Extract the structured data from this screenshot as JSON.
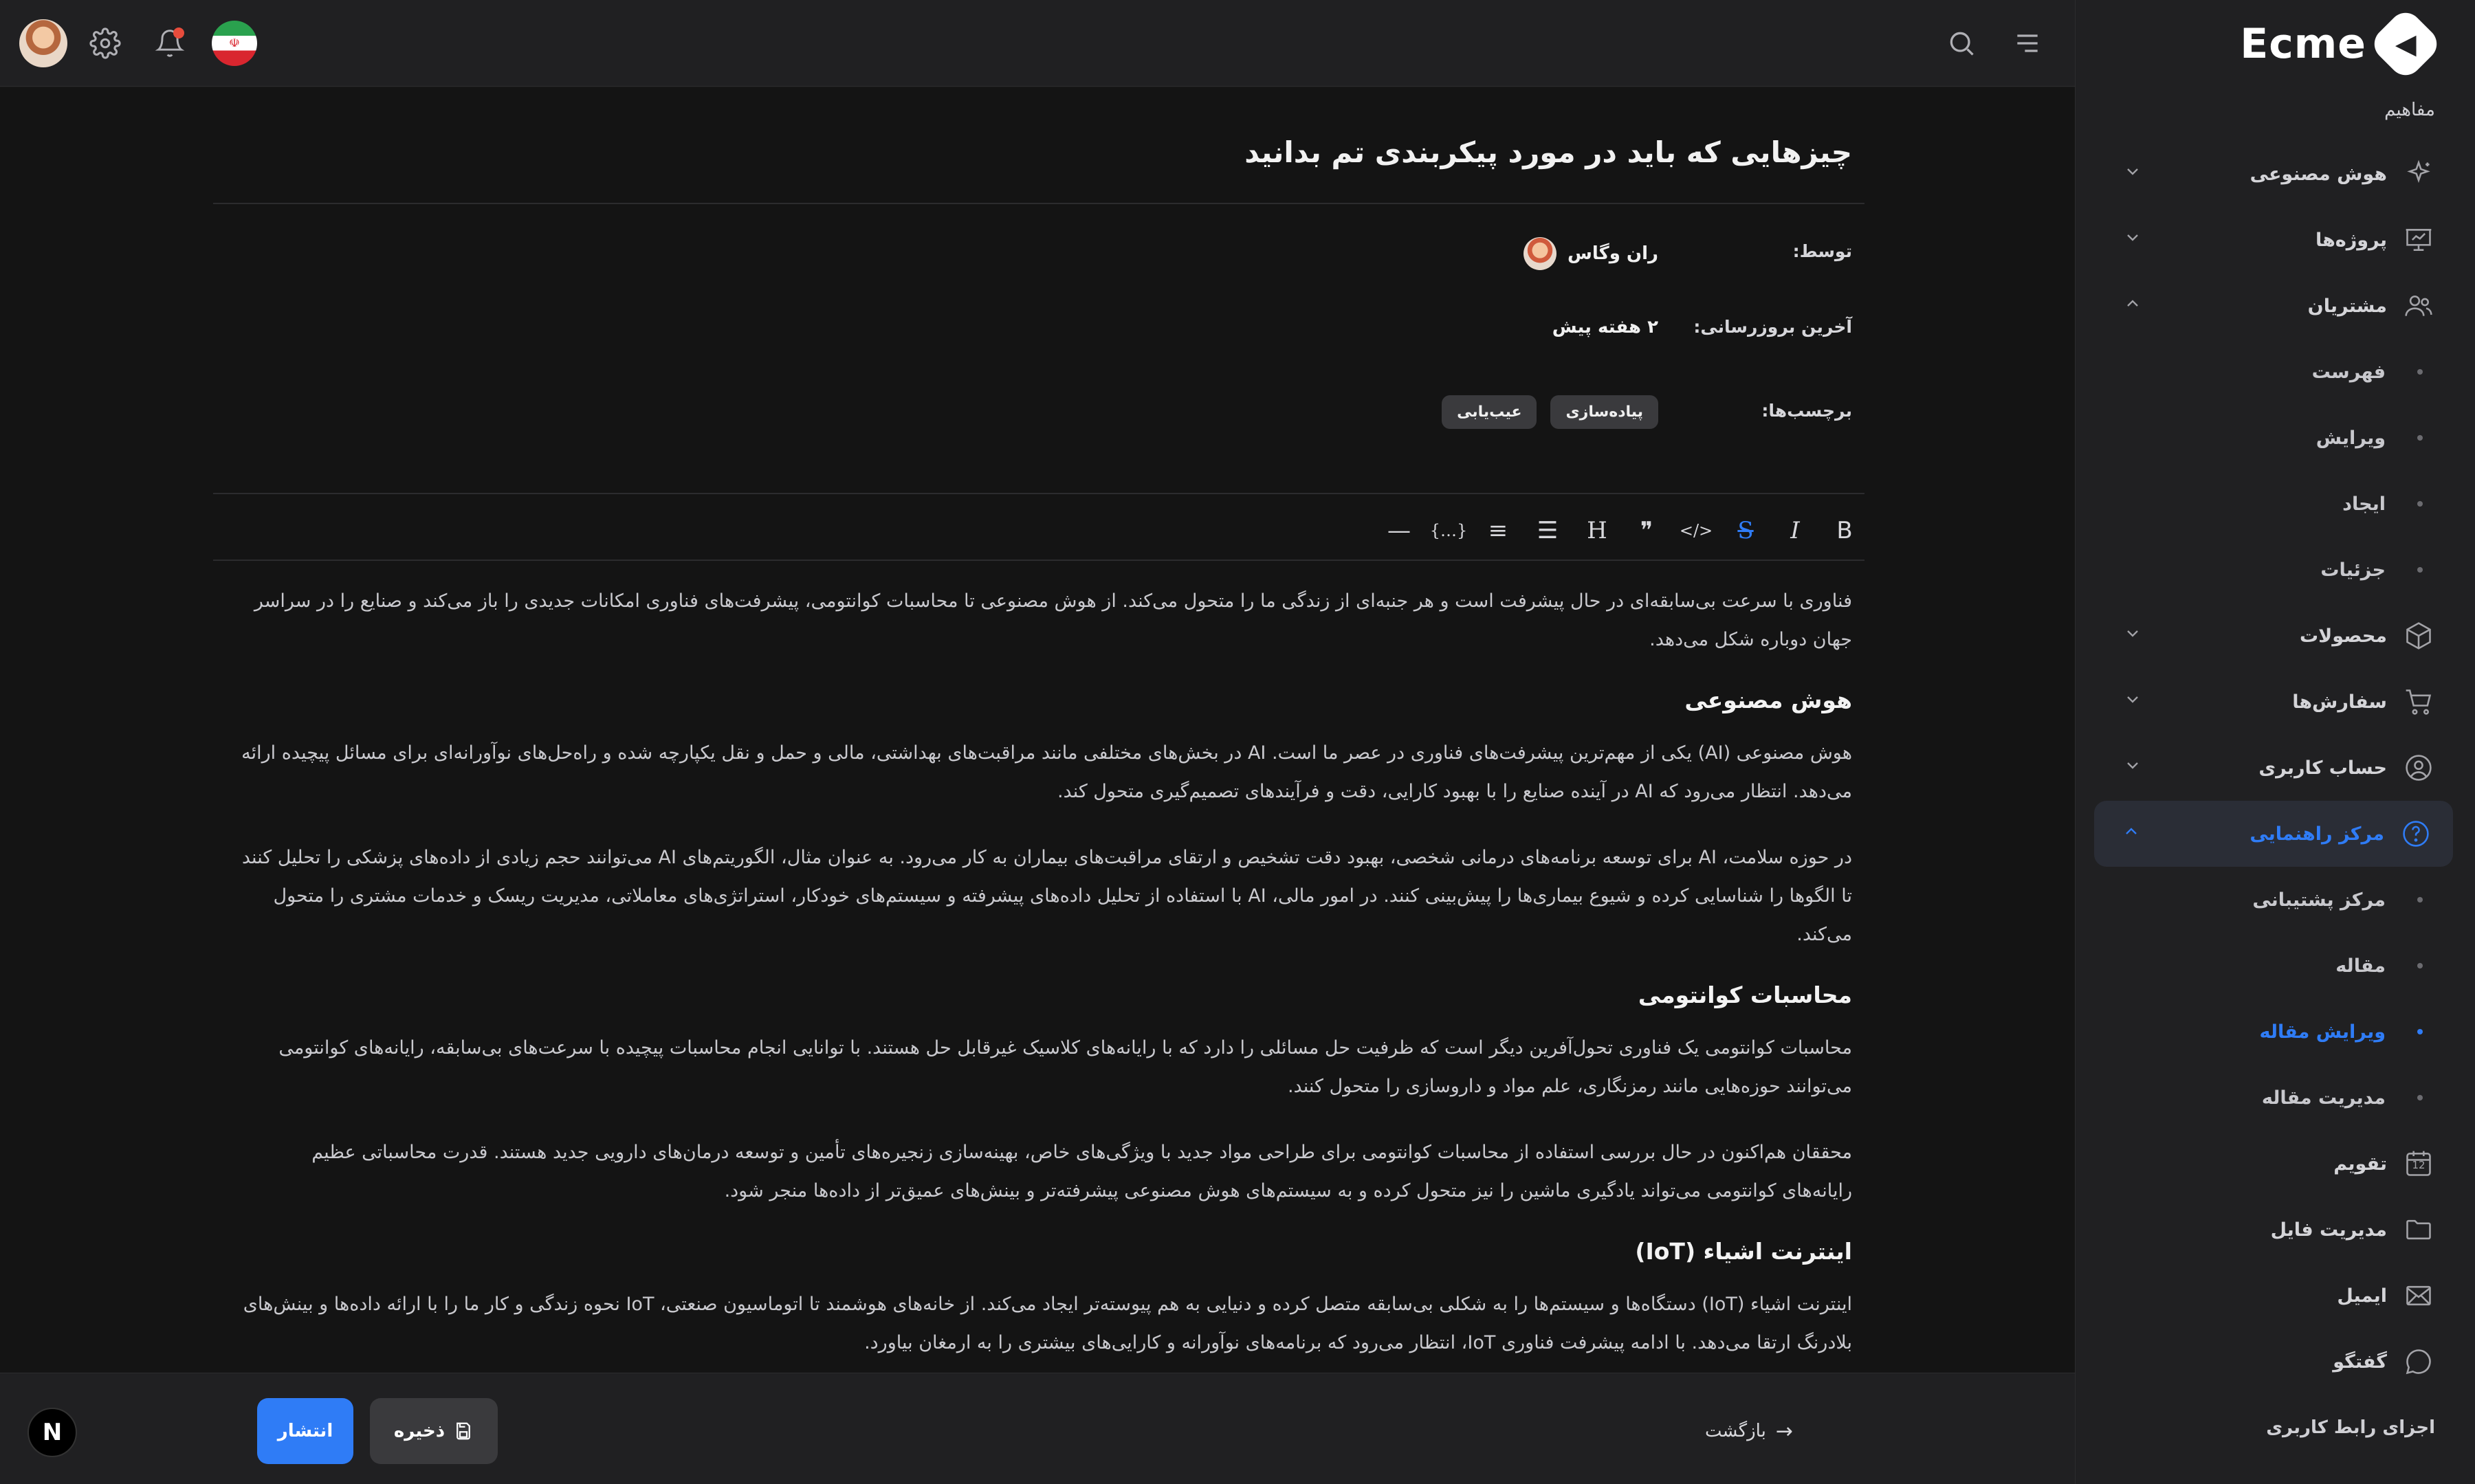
{
  "app": {
    "name": "Ecme"
  },
  "sidebar": {
    "section_title": "مفاهیم",
    "items": [
      {
        "label": "هوش مصنوعی",
        "icon": "sparkle-icon",
        "chevron": "down"
      },
      {
        "label": "پروژه‌ها",
        "icon": "presentation-icon",
        "chevron": "down"
      },
      {
        "label": "مشتریان",
        "icon": "users-icon",
        "chevron": "up"
      },
      {
        "label": "فهرست",
        "sub": true
      },
      {
        "label": "ویرایش",
        "sub": true
      },
      {
        "label": "ایجاد",
        "sub": true
      },
      {
        "label": "جزئیات",
        "sub": true
      },
      {
        "label": "محصولات",
        "icon": "box-icon",
        "chevron": "down"
      },
      {
        "label": "سفارش‌ها",
        "icon": "cart-icon",
        "chevron": "down"
      },
      {
        "label": "حساب کاربری",
        "icon": "user-circle-icon",
        "chevron": "down"
      },
      {
        "label": "مرکز راهنمایی",
        "icon": "help-icon",
        "chevron": "up",
        "active": true
      },
      {
        "label": "مرکز پشتیبانی",
        "sub": true
      },
      {
        "label": "مقاله",
        "sub": true
      },
      {
        "label": "ویرایش مقاله",
        "sub": true,
        "active": true
      },
      {
        "label": "مدیریت مقاله",
        "sub": true
      },
      {
        "label": "تقویم",
        "icon": "calendar-icon",
        "calendar_day": "12"
      },
      {
        "label": "مدیریت فایل",
        "icon": "folder-icon"
      },
      {
        "label": "ایمیل",
        "icon": "mail-icon"
      },
      {
        "label": "گفتگو",
        "icon": "chat-icon"
      }
    ],
    "bottom_section_title": "اجزای رابط کاربری"
  },
  "article": {
    "title": "چیزهایی که باید در مورد پیکربندی تم بدانید",
    "author_label": "توسط:",
    "author_name": "ران وگاس",
    "updated_label": "آخرین بروزرسانی:",
    "updated_value": "۲ هفته پیش",
    "tags_label": "برچسب‌ها:",
    "tags": [
      "پیاده‌سازی",
      "عیب‌یابی"
    ]
  },
  "toolbar": {
    "tools": [
      {
        "name": "bold",
        "glyph": "B"
      },
      {
        "name": "italic",
        "glyph": "I"
      },
      {
        "name": "strikethrough",
        "glyph": "S",
        "active": true
      },
      {
        "name": "code",
        "glyph": "</>"
      },
      {
        "name": "quote",
        "glyph": "❞"
      },
      {
        "name": "heading",
        "glyph": "H"
      },
      {
        "name": "bullet-list",
        "glyph": "☰"
      },
      {
        "name": "ordered-list",
        "glyph": "≡"
      },
      {
        "name": "code-block",
        "glyph": "{…}"
      },
      {
        "name": "horizontal-rule",
        "glyph": "—"
      }
    ]
  },
  "body": {
    "intro": "فناوری با سرعت بی‌سابقه‌ای در حال پیشرفت است و هر جنبه‌ای از زندگی ما را متحول می‌کند. از هوش مصنوعی تا محاسبات کوانتومی، پیشرفت‌های فناوری امکانات جدیدی را باز می‌کند و صنایع را در سراسر جهان دوباره شکل می‌دهد.",
    "h_ai": "هوش مصنوعی",
    "ai_p1": "هوش مصنوعی (AI) یکی از مهم‌ترین پیشرفت‌های فناوری در عصر ما است. AI در بخش‌های مختلفی مانند مراقبت‌های بهداشتی، مالی و حمل و نقل یکپارچه شده و راه‌حل‌های نوآورانه‌ای برای مسائل پیچیده ارائه می‌دهد. انتظار می‌رود که AI در آینده صنایع را با بهبود کارایی، دقت و فرآیندهای تصمیم‌گیری متحول کند.",
    "ai_p2": "در حوزه سلامت، AI برای توسعه برنامه‌های درمانی شخصی، بهبود دقت تشخیص و ارتقای مراقبت‌های بیماران به کار می‌رود. به عنوان مثال، الگوریتم‌های AI می‌توانند حجم زیادی از داده‌های پزشکی را تحلیل کنند تا الگوها را شناسایی کرده و شیوع بیماری‌ها را پیش‌بینی کنند. در امور مالی، AI با استفاده از تحلیل داده‌های پیشرفته و سیستم‌های خودکار، استراتژی‌های معاملاتی، مدیریت ریسک و خدمات مشتری را متحول می‌کند.",
    "h_quantum": "محاسبات کوانتومی",
    "q_p1": "محاسبات کوانتومی یک فناوری تحول‌آفرین دیگر است که ظرفیت حل مسائلی را دارد که با رایانه‌های کلاسیک غیرقابل حل هستند. با توانایی انجام محاسبات پیچیده با سرعت‌های بی‌سابقه، رایانه‌های کوانتومی می‌توانند حوزه‌هایی مانند رمزنگاری، علم مواد و داروسازی را متحول کنند.",
    "q_p2": "محققان هم‌اکنون در حال بررسی استفاده از محاسبات کوانتومی برای طراحی مواد جدید با ویژگی‌های خاص، بهینه‌سازی زنجیره‌های تأمین و توسعه درمان‌های دارویی جدید هستند. قدرت محاسباتی عظیم رایانه‌های کوانتومی می‌تواند یادگیری ماشین را نیز متحول کرده و به سیستم‌های هوش مصنوعی پیشرفته‌تر و بینش‌های عمیق‌تر از داده‌ها منجر شود.",
    "h_iot": "اینترنت اشیاء (IoT)",
    "iot_p1": "اینترنت اشیاء (IoT) دستگاه‌ها و سیستم‌ها را به شکلی بی‌سابقه متصل کرده و دنیایی به هم پیوسته‌تر ایجاد می‌کند. از خانه‌های هوشمند تا اتوماسیون صنعتی، IoT نحوه زندگی و کار ما را با ارائه داده‌ها و بینش‌های بلادرنگ ارتقا می‌دهد. با ادامه پیشرفت فناوری IoT، انتظار می‌رود که برنامه‌های نوآورانه و کارایی‌های بیشتری را به ارمغان بیاورد."
  },
  "footer": {
    "back_label": "بازگشت",
    "save_label": "ذخیره",
    "publish_label": "انتشار"
  },
  "badge": {
    "letter": "N"
  },
  "colors": {
    "accent": "#2f7cf6",
    "background": "#141414",
    "panel": "#202022"
  }
}
